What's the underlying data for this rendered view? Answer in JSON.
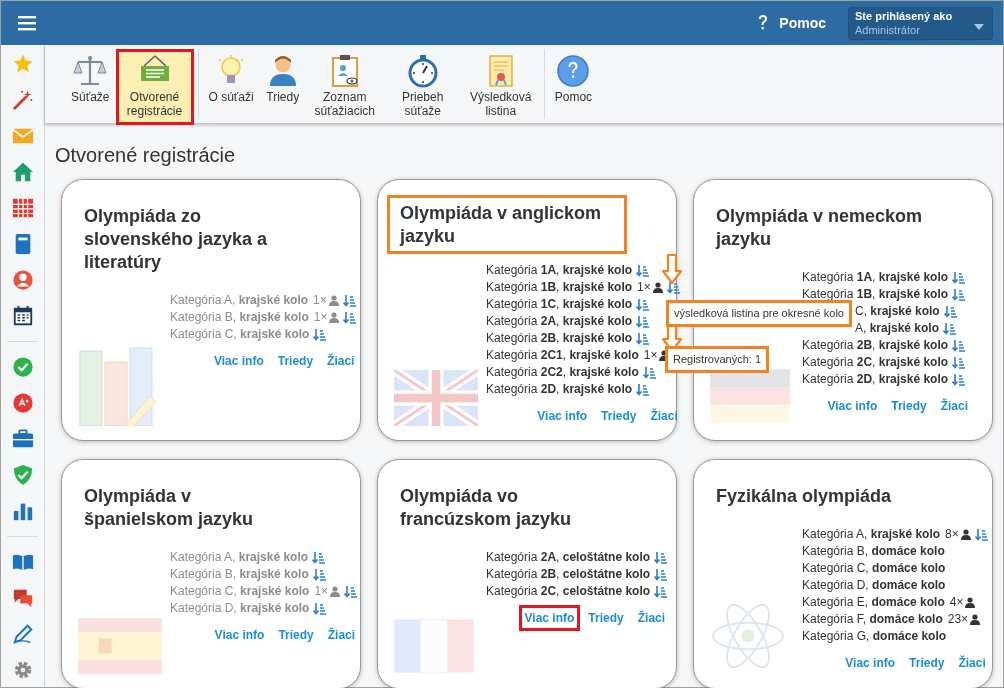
{
  "topbar": {
    "help": "Pomoc",
    "user_caption": "Ste prihlásený ako",
    "user": "Administrátor"
  },
  "toolbar_groups": [
    [
      {
        "label": "Súťaže",
        "selected": false,
        "highlighted": false
      },
      {
        "label": "Otvorené registrácie",
        "selected": true,
        "highlighted": true
      }
    ],
    [
      {
        "label": "O súťaži",
        "selected": false,
        "highlighted": false
      },
      {
        "label": "Triedy",
        "selected": false,
        "highlighted": false
      },
      {
        "label": "Zoznam súťažiacich",
        "selected": false,
        "highlighted": false
      },
      {
        "label": "Priebeh súťaže",
        "selected": false,
        "highlighted": false
      },
      {
        "label": "Výsledková listina",
        "selected": false,
        "highlighted": false
      }
    ],
    [
      {
        "label": "Pomoc",
        "selected": false,
        "highlighted": false
      }
    ]
  ],
  "heading": "Otvorené registrácie",
  "cards": [
    {
      "title": "Olympiáda zo slovenského jazyka a literatúry",
      "disabled": true,
      "highlighted": false,
      "rows": [
        {
          "text": "Kategória A, **krajské kolo**",
          "count": "1×",
          "results": true,
          "annotated": false
        },
        {
          "text": "Kategória B, **krajské kolo**",
          "count": "1×",
          "results": true,
          "annotated": false
        },
        {
          "text": "Kategória C, **krajské kolo**",
          "results": true,
          "annotated": false
        }
      ],
      "links": [
        {
          "label": "Viac info",
          "highlighted": false
        },
        {
          "label": "Triedy",
          "highlighted": false
        },
        {
          "label": "Žiaci",
          "highlighted": false
        }
      ]
    },
    {
      "title": "Olympiáda v anglickom jazyku",
      "disabled": false,
      "highlighted": true,
      "rows": [
        {
          "text": "Kategória **1A**, **krajské kolo**",
          "results": true,
          "annotated": false
        },
        {
          "text": "Kategória **1B**, **krajské kolo**",
          "count": "1×",
          "results": true,
          "annotated": true
        },
        {
          "text": "Kategória **1C**, **krajské kolo**",
          "results": true,
          "annotated": false
        },
        {
          "text": "Kategória **2A**, **krajské kolo**",
          "results": true,
          "annotated": false
        },
        {
          "text": "Kategória **2B**, **krajské kolo**",
          "results": true,
          "annotated": false
        },
        {
          "text": "Kategória **2C1**, **krajské kolo**",
          "count": "1×",
          "results": false,
          "annotated": true
        },
        {
          "text": "Kategória **2C2**, **krajské kolo**",
          "results": true,
          "annotated": false
        },
        {
          "text": "Kategória **2D**, **krajské kolo**",
          "results": true,
          "annotated": false
        }
      ],
      "links": [
        {
          "label": "Viac info",
          "highlighted": false
        },
        {
          "label": "Triedy",
          "highlighted": false
        },
        {
          "label": "Žiaci",
          "highlighted": false
        }
      ],
      "tooltips": [
        "výsledková listina pre okresné kolo",
        "Registrovaných: 1"
      ]
    },
    {
      "title": "Olympiáda v nemeckom jazyku",
      "disabled": false,
      "highlighted": false,
      "rows": [
        {
          "text": "Kategória **1A**, **krajské kolo**",
          "results": true,
          "annotated": false
        },
        {
          "text": "Kategória **1B**, **krajské kolo**",
          "results": true,
          "annotated": false
        },
        {
          "text": "C, **krajské kolo**",
          "results": true,
          "annotated": false
        },
        {
          "text": "A, **krajské kolo**",
          "results": true,
          "annotated": false
        },
        {
          "text": "Kategória **2B**, **krajské kolo**",
          "results": true,
          "annotated": false
        },
        {
          "text": "Kategória **2C**, **krajské kolo**",
          "results": true,
          "annotated": false
        },
        {
          "text": "Kategória **2D**, **krajské kolo**",
          "results": true,
          "annotated": false
        }
      ],
      "links": [
        {
          "label": "Viac info",
          "highlighted": false
        },
        {
          "label": "Triedy",
          "highlighted": false
        },
        {
          "label": "Žiaci",
          "highlighted": false
        }
      ]
    },
    {
      "title": "Olympiáda v španielskom jazyku",
      "disabled": true,
      "highlighted": false,
      "rows": [
        {
          "text": "Kategória A, **krajské kolo**",
          "results": true,
          "annotated": false
        },
        {
          "text": "Kategória B, **krajské kolo**",
          "results": true,
          "annotated": false
        },
        {
          "text": "Kategória C, **krajské kolo**",
          "count": "1×",
          "results": true,
          "annotated": false
        },
        {
          "text": "Kategória D, **krajské kolo**",
          "results": true,
          "annotated": false
        }
      ],
      "links": [
        {
          "label": "Viac info",
          "highlighted": false
        },
        {
          "label": "Triedy",
          "highlighted": false
        },
        {
          "label": "Žiaci",
          "highlighted": false
        }
      ]
    },
    {
      "title": "Olympiáda vo francúzskom jazyku",
      "disabled": false,
      "highlighted": false,
      "rows": [
        {
          "text": "Kategória **2A**, **celoštátne kolo**",
          "results": true,
          "annotated": false
        },
        {
          "text": "Kategória **2B**, **celoštátne kolo**",
          "results": true,
          "annotated": false
        },
        {
          "text": "Kategória **2C**, **celoštátne kolo**",
          "results": true,
          "annotated": false
        }
      ],
      "links": [
        {
          "label": "Viac info",
          "highlighted": true
        },
        {
          "label": "Triedy",
          "highlighted": false
        },
        {
          "label": "Žiaci",
          "highlighted": false
        }
      ]
    },
    {
      "title": "Fyzikálna olympiáda",
      "disabled": false,
      "highlighted": false,
      "rows": [
        {
          "text": "Kategória A, **krajské kolo**",
          "count": "8×",
          "results": true,
          "annotated": false
        },
        {
          "text": "Kategória B, **domáce kolo**",
          "results": false,
          "annotated": false
        },
        {
          "text": "Kategória C, **domáce kolo**",
          "results": false,
          "annotated": false
        },
        {
          "text": "Kategória D, **domáce kolo**",
          "results": false,
          "annotated": false
        },
        {
          "text": "Kategória E, **domáce kolo**",
          "count": "4×",
          "results": false,
          "annotated": false
        },
        {
          "text": "Kategória F, **domáce kolo**",
          "count": "23×",
          "results": false,
          "annotated": false
        },
        {
          "text": "Kategória G, **domáce kolo**",
          "results": false,
          "annotated": false
        }
      ],
      "links": [
        {
          "label": "Viac info",
          "highlighted": false
        },
        {
          "label": "Triedy",
          "highlighted": false
        },
        {
          "label": "Žiaci",
          "highlighted": false
        }
      ]
    }
  ]
}
